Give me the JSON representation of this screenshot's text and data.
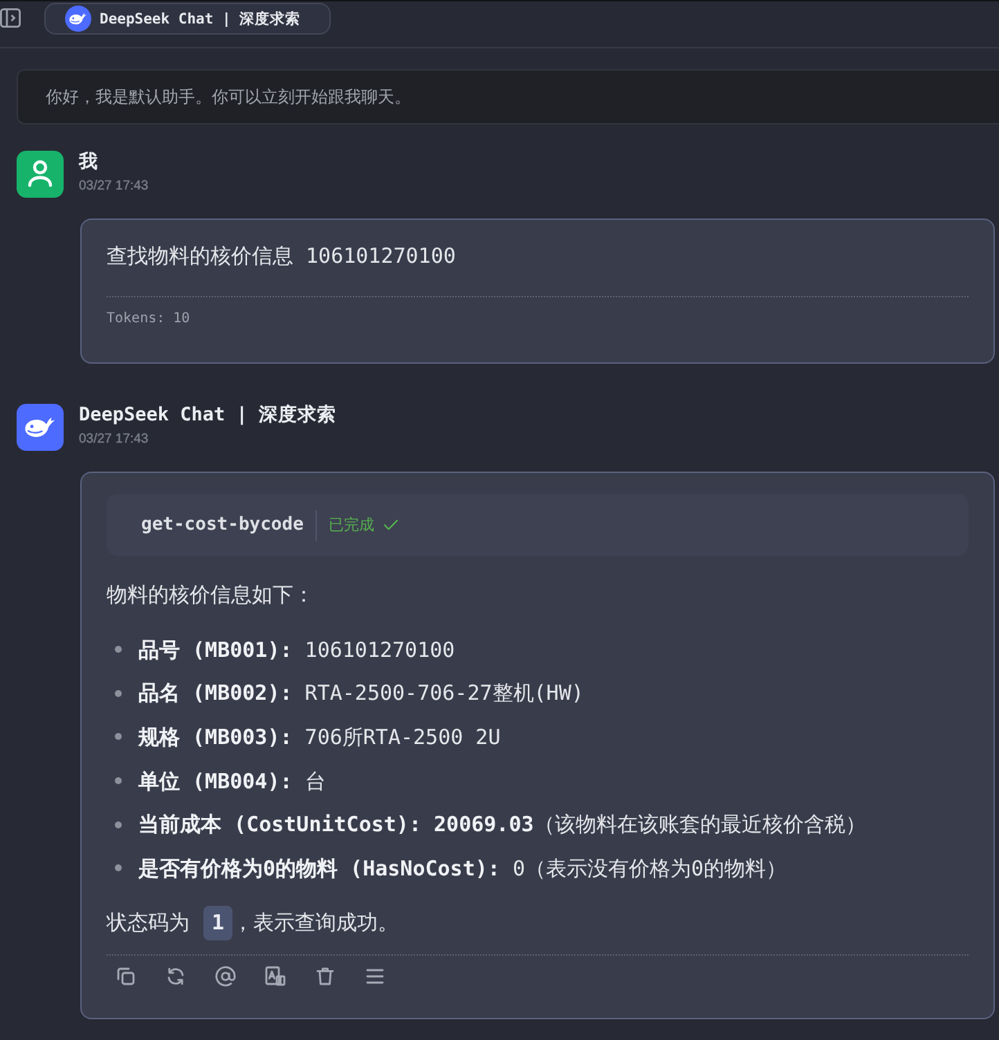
{
  "top_bar": {
    "tabs": [
      {
        "title": "DeepSeek Chat | 深度求索",
        "selected": true
      }
    ]
  },
  "system_message": "你好，我是默认助手。你可以立刻开始跟我聊天。",
  "messages": [
    {
      "kind": "user",
      "name": "我",
      "time": "03/27 17:43",
      "content": [
        {
          "kind": "paragraph",
          "text": "查找物料的核价信息 106101270100"
        }
      ],
      "tokens": "Tokens: 10"
    },
    {
      "kind": "assistant",
      "name": "DeepSeek Chat | 深度求索",
      "time": "03/27 17:43",
      "tool_call": {
        "name": "get-cost-bycode",
        "status": "已完成",
        "completed": true
      },
      "content": [
        {
          "kind": "paragraph",
          "text": "物料的核价信息如下："
        },
        {
          "kind": "bullets",
          "items": [
            "**品号 (MB001):** 106101270100",
            "**品名 (MB002):** RTA-2500-706-27整机(HW)",
            "**规格 (MB003):** 706所RTA-2500 2U",
            "**单位 (MB004):** 台",
            "**当前成本 (CostUnitCost):** **20069.03**（该物料在该账套的最近核价含税）",
            "**是否有价格为0的物料 (HasNoCost):** 0（表示没有价格为0的物料）"
          ]
        },
        {
          "kind": "status",
          "before": "状态码为",
          "code": "1",
          "after": "，表示查询成功。"
        }
      ]
    }
  ]
}
